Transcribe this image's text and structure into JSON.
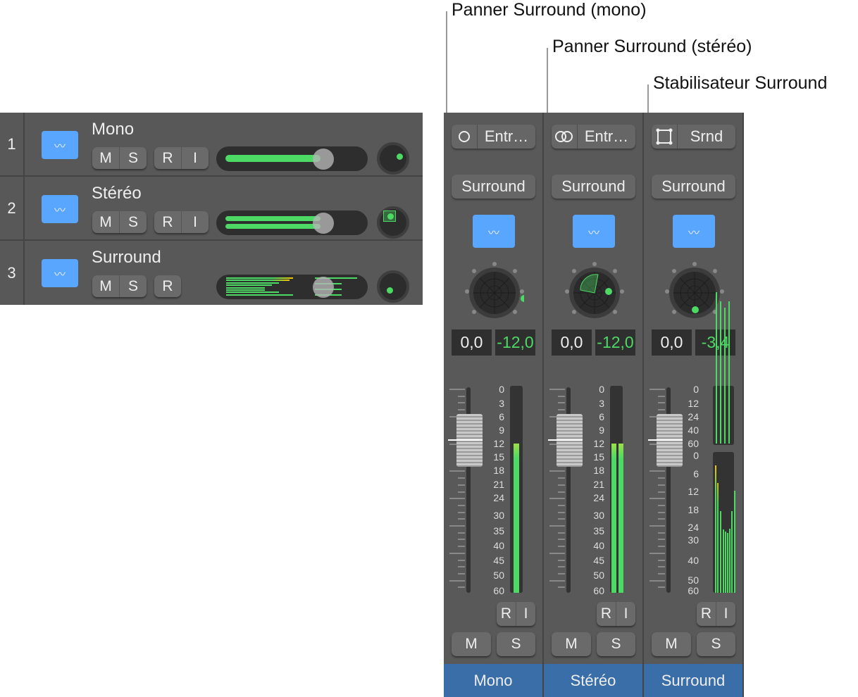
{
  "callouts": [
    "Panner Surround (mono)",
    "Panner Surround (stéréo)",
    "Stabilisateur Surround"
  ],
  "tracks": [
    {
      "number": "1",
      "name": "Mono",
      "buttons": [
        "M",
        "S",
        "R",
        "I"
      ],
      "volume_fraction": 0.62,
      "pan": "mono"
    },
    {
      "number": "2",
      "name": "Stéréo",
      "buttons": [
        "M",
        "S",
        "R",
        "I"
      ],
      "volume_fraction": 0.62,
      "pan": "stereo"
    },
    {
      "number": "3",
      "name": "Surround",
      "buttons": [
        "M",
        "S",
        "R"
      ],
      "volume_fraction": 0.62,
      "pan": "surround"
    }
  ],
  "strips": [
    {
      "input_icon": "mono-circle-icon",
      "input_label": "Entr…",
      "output_label": "Surround",
      "volume": "0,0",
      "peak": "-12,0",
      "name": "Mono",
      "ri": [
        "R",
        "I"
      ],
      "ms": [
        "M",
        "S"
      ],
      "meter_db": [
        -12
      ]
    },
    {
      "input_icon": "stereo-circles-icon",
      "input_label": "Entr…",
      "output_label": "Surround",
      "volume": "0,0",
      "peak": "-12,0",
      "name": "Stéréo",
      "ri": [
        "R",
        "I"
      ],
      "ms": [
        "M",
        "S"
      ],
      "meter_db": [
        -12,
        -12
      ]
    },
    {
      "input_icon": "surround-square-icon",
      "input_label": "Srnd",
      "output_label": "Surround",
      "volume": "0,0",
      "peak": "-3,4",
      "name": "Surround",
      "ri": [
        "R",
        "I"
      ],
      "ms": [
        "M",
        "S"
      ]
    }
  ],
  "scale": [
    "0",
    "3",
    "6",
    "9",
    "12",
    "15",
    "18",
    "21",
    "24",
    "30",
    "35",
    "40",
    "45",
    "50",
    "60"
  ],
  "surround_scale_top": [
    "0",
    "12",
    "24",
    "40",
    "60"
  ],
  "surround_scale_bottom": [
    "0",
    "6",
    "12",
    "18",
    "24",
    "30",
    "40",
    "50",
    "60"
  ],
  "colors": {
    "accent": "#58a6ff",
    "meter": "#4cd964",
    "name_bar": "#3a6ea8"
  }
}
